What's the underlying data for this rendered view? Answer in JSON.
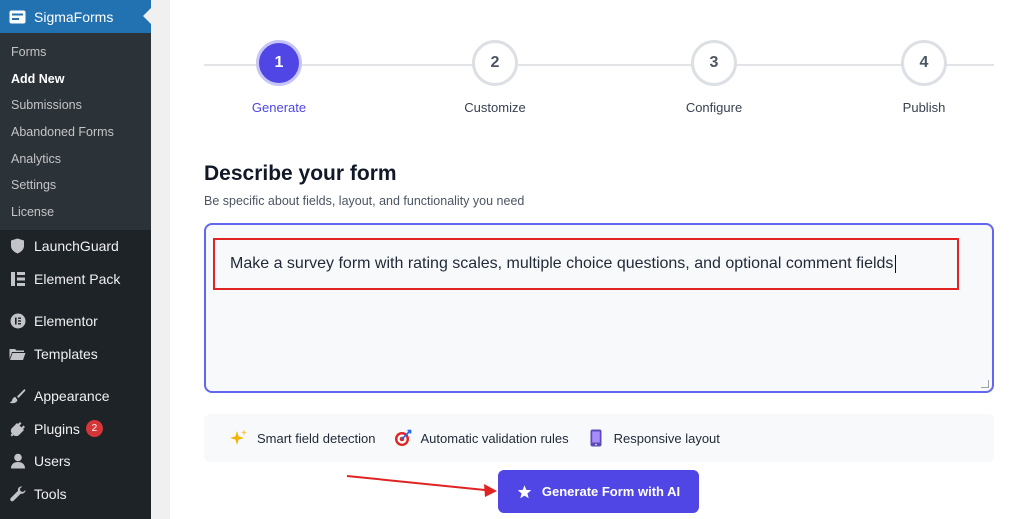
{
  "sidebar": {
    "plugin_title": "SigmaForms",
    "submenu": [
      {
        "label": "Forms",
        "active": false
      },
      {
        "label": "Add New",
        "active": true
      },
      {
        "label": "Submissions",
        "active": false
      },
      {
        "label": "Abandoned Forms",
        "active": false
      },
      {
        "label": "Analytics",
        "active": false
      },
      {
        "label": "Settings",
        "active": false
      },
      {
        "label": "License",
        "active": false
      }
    ],
    "menu": [
      {
        "label": "LaunchGuard",
        "icon": "shield-icon"
      },
      {
        "label": "Element Pack",
        "icon": "element-pack-icon"
      },
      {
        "label": "Elementor",
        "icon": "elementor-icon"
      },
      {
        "label": "Templates",
        "icon": "folder-icon"
      },
      {
        "label": "Appearance",
        "icon": "brush-icon"
      },
      {
        "label": "Plugins",
        "icon": "plug-icon",
        "badge": "2"
      },
      {
        "label": "Users",
        "icon": "user-icon"
      },
      {
        "label": "Tools",
        "icon": "wrench-icon"
      }
    ]
  },
  "stepper": {
    "steps": [
      {
        "number": "1",
        "label": "Generate",
        "active": true
      },
      {
        "number": "2",
        "label": "Customize",
        "active": false
      },
      {
        "number": "3",
        "label": "Configure",
        "active": false
      },
      {
        "number": "4",
        "label": "Publish",
        "active": false
      }
    ]
  },
  "form": {
    "title": "Describe your form",
    "subtitle": "Be specific about fields, layout, and functionality you need",
    "prompt_value": "Make a survey form with rating scales, multiple choice questions, and optional comment fields"
  },
  "features": [
    {
      "label": "Smart field detection",
      "icon": "sparkles-icon"
    },
    {
      "label": "Automatic validation rules",
      "icon": "target-icon"
    },
    {
      "label": "Responsive layout",
      "icon": "mobile-icon"
    }
  ],
  "generate_button": {
    "label": "Generate Form with AI",
    "icon": "star-icon"
  },
  "colors": {
    "accent": "#4f46e5",
    "sidebar_bg": "#1d2327",
    "sidebar_active": "#2271b1",
    "annotation_red": "#e02424"
  }
}
